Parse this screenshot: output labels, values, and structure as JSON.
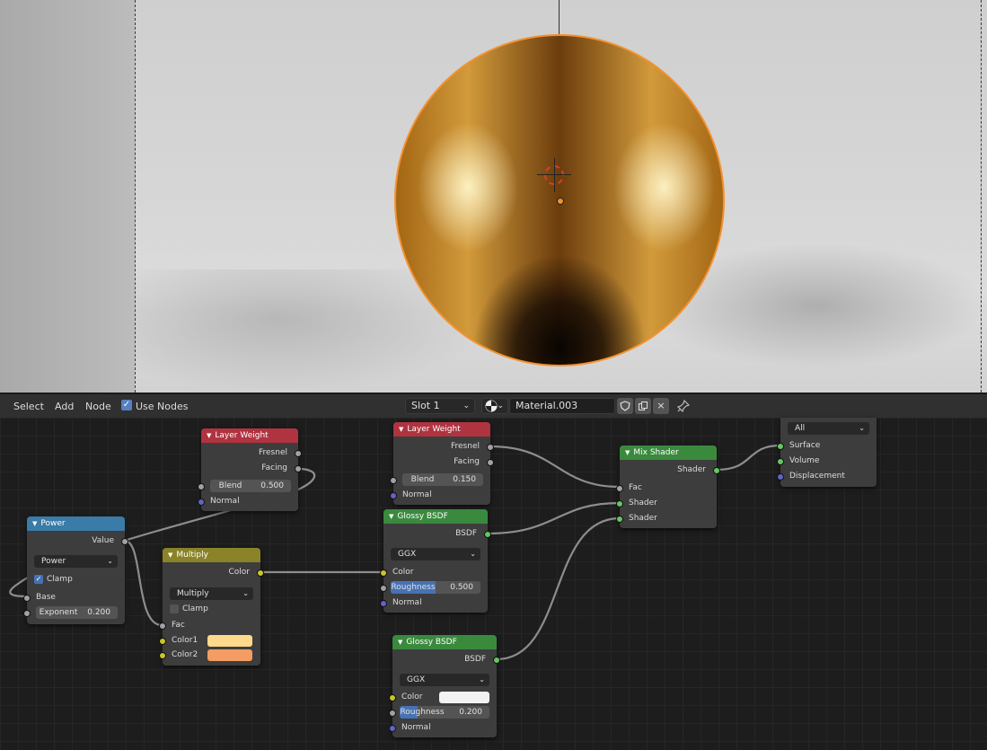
{
  "header": {
    "menu": {
      "select": "Select",
      "add": "Add",
      "node": "Node"
    },
    "use_nodes_label": "Use Nodes",
    "slot": "Slot 1",
    "material_name": "Material.003",
    "close_icon": "×"
  },
  "icons": [
    "checkbox-icon",
    "sphere-material-icon",
    "shield-icon",
    "duplicate-icon",
    "close-icon",
    "pin-icon"
  ],
  "colors": {
    "color1_swatch": "#ffd98c",
    "color2_swatch": "#f39c63",
    "glossy2_color": "#f2f2f2",
    "selection_outline": "#f39130"
  },
  "nodes": {
    "layer_weight_1": {
      "title": "Layer Weight",
      "fresnel": "Fresnel",
      "facing": "Facing",
      "blend_label": "Blend",
      "blend_value": "0.500",
      "normal": "Normal"
    },
    "layer_weight_2": {
      "title": "Layer Weight",
      "fresnel": "Fresnel",
      "facing": "Facing",
      "blend_label": "Blend",
      "blend_value": "0.150",
      "normal": "Normal"
    },
    "power": {
      "title": "Power",
      "value": "Value",
      "operation": "Power",
      "clamp": "Clamp",
      "base": "Base",
      "exponent_label": "Exponent",
      "exponent_value": "0.200"
    },
    "multiply": {
      "title": "Multiply",
      "color": "Color",
      "blend_type": "Multiply",
      "clamp": "Clamp",
      "fac": "Fac",
      "color1": "Color1",
      "color2": "Color2"
    },
    "glossy_1": {
      "title": "Glossy BSDF",
      "bsdf": "BSDF",
      "distribution": "GGX",
      "color": "Color",
      "roughness_label": "Roughness",
      "roughness_value": "0.500",
      "roughness": 0.5,
      "normal": "Normal"
    },
    "glossy_2": {
      "title": "Glossy BSDF",
      "bsdf": "BSDF",
      "distribution": "GGX",
      "color": "Color",
      "roughness_label": "Roughness",
      "roughness_value": "0.200",
      "roughness": 0.2,
      "normal": "Normal"
    },
    "mix_shader": {
      "title": "Mix Shader",
      "shader_out": "Shader",
      "fac": "Fac",
      "shader1": "Shader",
      "shader2": "Shader"
    },
    "output": {
      "target": "All",
      "surface": "Surface",
      "volume": "Volume",
      "displacement": "Displacement"
    }
  }
}
